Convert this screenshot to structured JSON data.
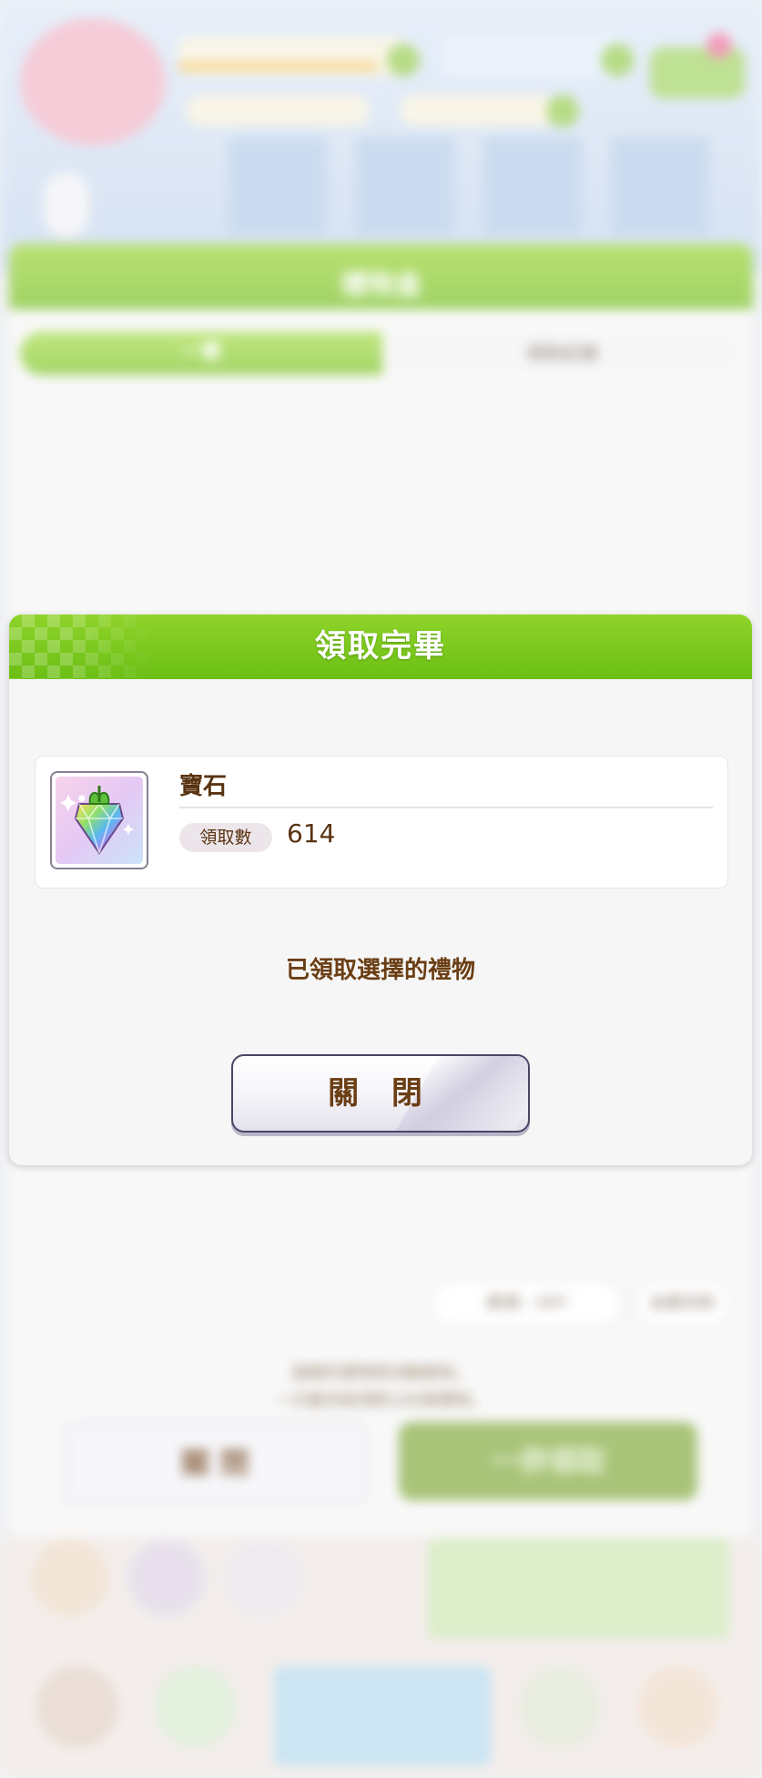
{
  "background": {
    "gift_box_title": "禮物盒",
    "tabs": [
      "一覽",
      "領取紀錄"
    ],
    "filter_pill": "篩選：OFF",
    "sort_pill": "由舊到新",
    "note_lines": [
      "過期的禮物將自動刪除。",
      "一次最多能領取100個禮物。"
    ],
    "close_label": "關 閉",
    "claim_all_label": "一併領取"
  },
  "dialog": {
    "title": "領取完畢",
    "item": {
      "name": "寶石",
      "count_label": "領取數",
      "count_value": "614",
      "icon": "rainbow-gem-icon"
    },
    "message": "已領取選擇的禮物",
    "close_label": "關 閉"
  },
  "colors": {
    "header_green": "#7bc520",
    "text_brown": "#6b3e14",
    "panel_bg": "#f6f6f7"
  }
}
